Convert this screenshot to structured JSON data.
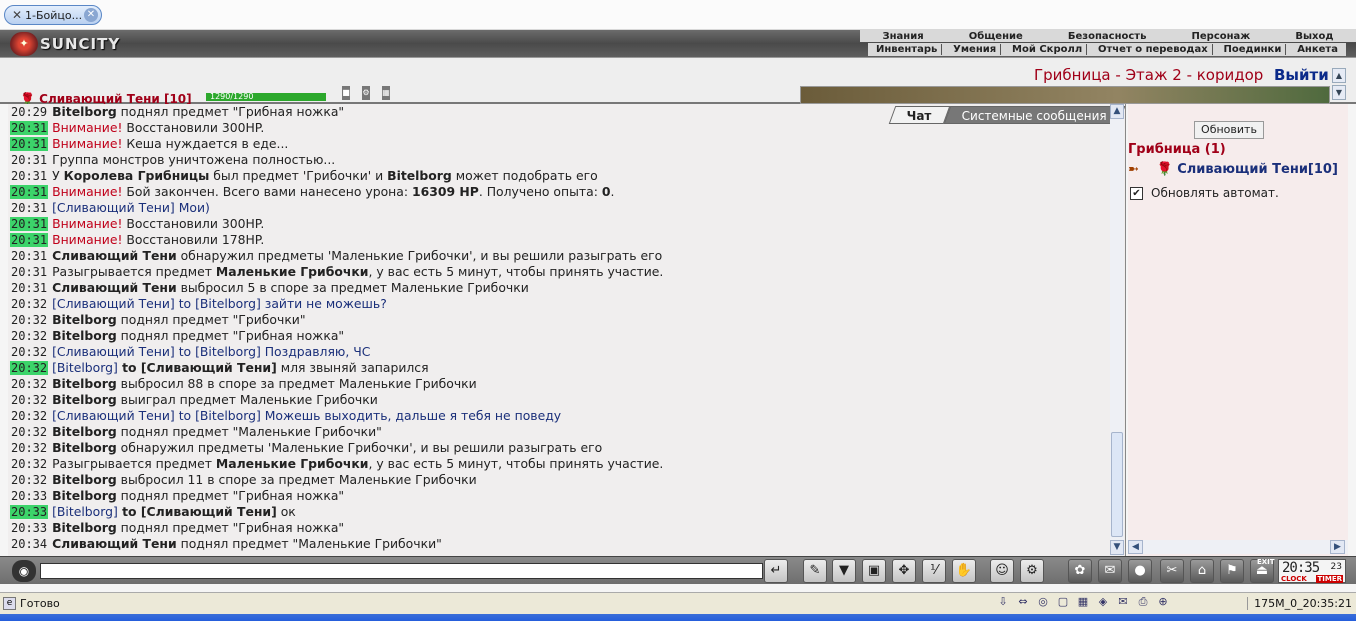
{
  "browser_tab": {
    "title": "1-Бойцо...",
    "icon": "page-icon"
  },
  "header": {
    "logo": "SUNCITY",
    "menu_top": [
      "Знания",
      "Общение",
      "Безопасность",
      "Персонаж",
      "Выход"
    ],
    "menu_bottom": [
      "Инвентарь",
      "Умения",
      "Мой Скролл",
      "Отчет о переводах",
      "Поединки",
      "Анкета"
    ]
  },
  "location": {
    "title": "Грибница - Этаж 2 - коридор",
    "exit_label": "Выйти"
  },
  "player": {
    "name": "Сливающий Тени [10]",
    "hp": "1290/1290"
  },
  "chat": {
    "tabs": [
      "Чат",
      "Системные сообщения"
    ],
    "lines": [
      {
        "time": "20:29",
        "hl": false,
        "parts": [
          {
            "t": "Bitelborg",
            "c": "b"
          },
          {
            "t": " поднял предмет \"Грибная ножка\"",
            "c": ""
          }
        ]
      },
      {
        "time": "20:31",
        "hl": true,
        "parts": [
          {
            "t": "Внимание!",
            "c": "warn"
          },
          {
            "t": " Восстановили 300HP.",
            "c": ""
          }
        ]
      },
      {
        "time": "20:31",
        "hl": true,
        "parts": [
          {
            "t": "Внимание!",
            "c": "warn"
          },
          {
            "t": " Кеша нуждается в еде...",
            "c": ""
          }
        ]
      },
      {
        "time": "20:31",
        "hl": false,
        "parts": [
          {
            "t": "Группа монстров уничтожена полностью...",
            "c": ""
          }
        ]
      },
      {
        "time": "20:31",
        "hl": false,
        "parts": [
          {
            "t": "У ",
            "c": ""
          },
          {
            "t": "Королева Грибницы",
            "c": "b"
          },
          {
            "t": " был предмет 'Грибочки' и ",
            "c": ""
          },
          {
            "t": "Bitelborg",
            "c": "b"
          },
          {
            "t": " может подобрать его",
            "c": ""
          }
        ]
      },
      {
        "time": "20:31",
        "hl": true,
        "parts": [
          {
            "t": "Внимание!",
            "c": "warn"
          },
          {
            "t": " Бой закончен. Всего вами нанесено урона: ",
            "c": ""
          },
          {
            "t": "16309 HP",
            "c": "b"
          },
          {
            "t": ". Получено опыта: ",
            "c": ""
          },
          {
            "t": "0",
            "c": "b"
          },
          {
            "t": ".",
            "c": ""
          }
        ]
      },
      {
        "time": "20:31",
        "hl": false,
        "parts": [
          {
            "t": "[Сливающий Тени] Мои)",
            "c": "priv"
          }
        ]
      },
      {
        "time": "20:31",
        "hl": true,
        "parts": [
          {
            "t": "Внимание!",
            "c": "warn"
          },
          {
            "t": " Восстановили 300HP.",
            "c": ""
          }
        ]
      },
      {
        "time": "20:31",
        "hl": true,
        "parts": [
          {
            "t": "Внимание!",
            "c": "warn"
          },
          {
            "t": " Восстановили 178HP.",
            "c": ""
          }
        ]
      },
      {
        "time": "20:31",
        "hl": false,
        "parts": [
          {
            "t": "Сливающий Тени",
            "c": "b"
          },
          {
            "t": " обнаружил предметы 'Маленькие Грибочки', и вы решили разыграть его",
            "c": ""
          }
        ]
      },
      {
        "time": "20:31",
        "hl": false,
        "parts": [
          {
            "t": "Разыгрывается предмет ",
            "c": ""
          },
          {
            "t": "Маленькие Грибочки",
            "c": "b"
          },
          {
            "t": ", у вас есть 5 минут, чтобы принять участие.",
            "c": ""
          }
        ]
      },
      {
        "time": "20:31",
        "hl": false,
        "parts": [
          {
            "t": "Сливающий Тени",
            "c": "b"
          },
          {
            "t": " выбросил 5 в споре за предмет Маленькие Грибочки",
            "c": ""
          }
        ]
      },
      {
        "time": "20:32",
        "hl": false,
        "parts": [
          {
            "t": "[Сливающий Тени] to [Bitelborg] зайти не можешь?",
            "c": "priv"
          }
        ]
      },
      {
        "time": "20:32",
        "hl": false,
        "parts": [
          {
            "t": "Bitelborg",
            "c": "b"
          },
          {
            "t": " поднял предмет \"Грибочки\"",
            "c": ""
          }
        ]
      },
      {
        "time": "20:32",
        "hl": false,
        "parts": [
          {
            "t": "Bitelborg",
            "c": "b"
          },
          {
            "t": " поднял предмет \"Грибная ножка\"",
            "c": ""
          }
        ]
      },
      {
        "time": "20:32",
        "hl": false,
        "parts": [
          {
            "t": "[Сливающий Тени] to [Bitelborg] Поздравляю, ЧС",
            "c": "priv"
          }
        ]
      },
      {
        "time": "20:32",
        "hl": true,
        "parts": [
          {
            "t": "[Bitelborg]",
            "c": "priv"
          },
          {
            "t": " to [Сливающий Тени]",
            "c": "b"
          },
          {
            "t": " мля звыняй запарился",
            "c": ""
          }
        ]
      },
      {
        "time": "20:32",
        "hl": false,
        "parts": [
          {
            "t": "Bitelborg",
            "c": "b"
          },
          {
            "t": " выбросил 88 в споре за предмет Маленькие Грибочки",
            "c": ""
          }
        ]
      },
      {
        "time": "20:32",
        "hl": false,
        "parts": [
          {
            "t": "Bitelborg",
            "c": "b"
          },
          {
            "t": " выиграл предмет Маленькие Грибочки",
            "c": ""
          }
        ]
      },
      {
        "time": "20:32",
        "hl": false,
        "parts": [
          {
            "t": "[Сливающий Тени] to [Bitelborg] Можешь выходить, дальше я тебя не поведу",
            "c": "priv"
          }
        ]
      },
      {
        "time": "20:32",
        "hl": false,
        "parts": [
          {
            "t": "Bitelborg",
            "c": "b"
          },
          {
            "t": " поднял предмет \"Маленькие Грибочки\"",
            "c": ""
          }
        ]
      },
      {
        "time": "20:32",
        "hl": false,
        "parts": [
          {
            "t": "Bitelborg",
            "c": "b"
          },
          {
            "t": " обнаружил предметы 'Маленькие Грибочки', и вы решили разыграть его",
            "c": ""
          }
        ]
      },
      {
        "time": "20:32",
        "hl": false,
        "parts": [
          {
            "t": "Разыгрывается предмет ",
            "c": ""
          },
          {
            "t": "Маленькие Грибочки",
            "c": "b"
          },
          {
            "t": ", у вас есть 5 минут, чтобы принять участие.",
            "c": ""
          }
        ]
      },
      {
        "time": "20:32",
        "hl": false,
        "parts": [
          {
            "t": "Bitelborg",
            "c": "b"
          },
          {
            "t": " выбросил 11 в споре за предмет Маленькие Грибочки",
            "c": ""
          }
        ]
      },
      {
        "time": "20:33",
        "hl": false,
        "parts": [
          {
            "t": "Bitelborg",
            "c": "b"
          },
          {
            "t": " поднял предмет \"Грибная ножка\"",
            "c": ""
          }
        ]
      },
      {
        "time": "20:33",
        "hl": true,
        "parts": [
          {
            "t": "[Bitelborg]",
            "c": "priv"
          },
          {
            "t": " to [Сливающий Тени]",
            "c": "b"
          },
          {
            "t": " ок",
            "c": ""
          }
        ]
      },
      {
        "time": "20:33",
        "hl": false,
        "parts": [
          {
            "t": "Bitelborg",
            "c": "b"
          },
          {
            "t": " поднял предмет \"Грибная ножка\"",
            "c": ""
          }
        ]
      },
      {
        "time": "20:34",
        "hl": false,
        "parts": [
          {
            "t": "Сливающий Тени",
            "c": "b"
          },
          {
            "t": " поднял предмет \"Маленькие Грибочки\"",
            "c": ""
          }
        ]
      }
    ]
  },
  "side": {
    "refresh_label": "Обновить",
    "room_title": "Грибница (1)",
    "member": "Сливающий Тени[10]",
    "auto_refresh_label": "Обновлять автомат.",
    "auto_refresh_checked": true
  },
  "toolbar": {
    "icons": [
      "send-icon",
      "eraser-icon",
      "filter-icon",
      "save-icon",
      "walk-icon",
      "pl-icon",
      "hand-icon",
      "smile-icon",
      "settings-icon",
      "bag-icon",
      "scroll-icon",
      "bomb-icon",
      "tools-icon",
      "chest-icon",
      "flag-icon"
    ],
    "exit_label": "EXIT",
    "clock": "20:35",
    "clock_sec": "23",
    "clock_lbl": "CLOCK",
    "timer_lbl": "TIMER"
  },
  "status": {
    "text": "Готово",
    "id": "175M_0_20:35:21"
  },
  "colors": {
    "accent_red": "#a00018",
    "private_blue": "#1a2f7a",
    "hl_green": "#3cd46a",
    "hp_green": "#2ca82c"
  }
}
